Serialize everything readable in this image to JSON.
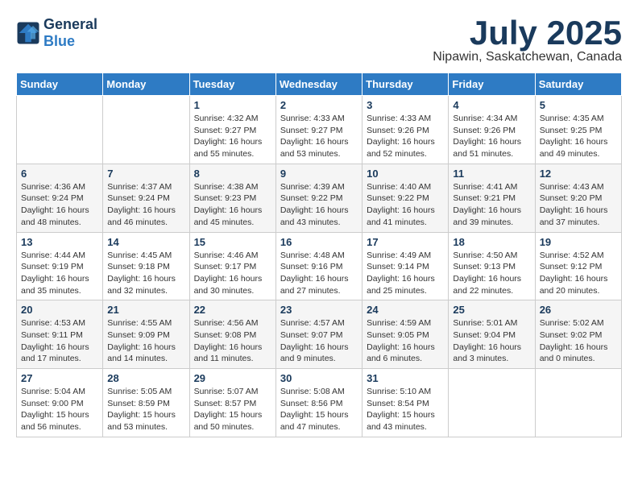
{
  "header": {
    "logo_line1": "General",
    "logo_line2": "Blue",
    "month_title": "July 2025",
    "location": "Nipawin, Saskatchewan, Canada"
  },
  "weekdays": [
    "Sunday",
    "Monday",
    "Tuesday",
    "Wednesday",
    "Thursday",
    "Friday",
    "Saturday"
  ],
  "weeks": [
    [
      {
        "day": "",
        "info": ""
      },
      {
        "day": "",
        "info": ""
      },
      {
        "day": "1",
        "info": "Sunrise: 4:32 AM\nSunset: 9:27 PM\nDaylight: 16 hours\nand 55 minutes."
      },
      {
        "day": "2",
        "info": "Sunrise: 4:33 AM\nSunset: 9:27 PM\nDaylight: 16 hours\nand 53 minutes."
      },
      {
        "day": "3",
        "info": "Sunrise: 4:33 AM\nSunset: 9:26 PM\nDaylight: 16 hours\nand 52 minutes."
      },
      {
        "day": "4",
        "info": "Sunrise: 4:34 AM\nSunset: 9:26 PM\nDaylight: 16 hours\nand 51 minutes."
      },
      {
        "day": "5",
        "info": "Sunrise: 4:35 AM\nSunset: 9:25 PM\nDaylight: 16 hours\nand 49 minutes."
      }
    ],
    [
      {
        "day": "6",
        "info": "Sunrise: 4:36 AM\nSunset: 9:24 PM\nDaylight: 16 hours\nand 48 minutes."
      },
      {
        "day": "7",
        "info": "Sunrise: 4:37 AM\nSunset: 9:24 PM\nDaylight: 16 hours\nand 46 minutes."
      },
      {
        "day": "8",
        "info": "Sunrise: 4:38 AM\nSunset: 9:23 PM\nDaylight: 16 hours\nand 45 minutes."
      },
      {
        "day": "9",
        "info": "Sunrise: 4:39 AM\nSunset: 9:22 PM\nDaylight: 16 hours\nand 43 minutes."
      },
      {
        "day": "10",
        "info": "Sunrise: 4:40 AM\nSunset: 9:22 PM\nDaylight: 16 hours\nand 41 minutes."
      },
      {
        "day": "11",
        "info": "Sunrise: 4:41 AM\nSunset: 9:21 PM\nDaylight: 16 hours\nand 39 minutes."
      },
      {
        "day": "12",
        "info": "Sunrise: 4:43 AM\nSunset: 9:20 PM\nDaylight: 16 hours\nand 37 minutes."
      }
    ],
    [
      {
        "day": "13",
        "info": "Sunrise: 4:44 AM\nSunset: 9:19 PM\nDaylight: 16 hours\nand 35 minutes."
      },
      {
        "day": "14",
        "info": "Sunrise: 4:45 AM\nSunset: 9:18 PM\nDaylight: 16 hours\nand 32 minutes."
      },
      {
        "day": "15",
        "info": "Sunrise: 4:46 AM\nSunset: 9:17 PM\nDaylight: 16 hours\nand 30 minutes."
      },
      {
        "day": "16",
        "info": "Sunrise: 4:48 AM\nSunset: 9:16 PM\nDaylight: 16 hours\nand 27 minutes."
      },
      {
        "day": "17",
        "info": "Sunrise: 4:49 AM\nSunset: 9:14 PM\nDaylight: 16 hours\nand 25 minutes."
      },
      {
        "day": "18",
        "info": "Sunrise: 4:50 AM\nSunset: 9:13 PM\nDaylight: 16 hours\nand 22 minutes."
      },
      {
        "day": "19",
        "info": "Sunrise: 4:52 AM\nSunset: 9:12 PM\nDaylight: 16 hours\nand 20 minutes."
      }
    ],
    [
      {
        "day": "20",
        "info": "Sunrise: 4:53 AM\nSunset: 9:11 PM\nDaylight: 16 hours\nand 17 minutes."
      },
      {
        "day": "21",
        "info": "Sunrise: 4:55 AM\nSunset: 9:09 PM\nDaylight: 16 hours\nand 14 minutes."
      },
      {
        "day": "22",
        "info": "Sunrise: 4:56 AM\nSunset: 9:08 PM\nDaylight: 16 hours\nand 11 minutes."
      },
      {
        "day": "23",
        "info": "Sunrise: 4:57 AM\nSunset: 9:07 PM\nDaylight: 16 hours\nand 9 minutes."
      },
      {
        "day": "24",
        "info": "Sunrise: 4:59 AM\nSunset: 9:05 PM\nDaylight: 16 hours\nand 6 minutes."
      },
      {
        "day": "25",
        "info": "Sunrise: 5:01 AM\nSunset: 9:04 PM\nDaylight: 16 hours\nand 3 minutes."
      },
      {
        "day": "26",
        "info": "Sunrise: 5:02 AM\nSunset: 9:02 PM\nDaylight: 16 hours\nand 0 minutes."
      }
    ],
    [
      {
        "day": "27",
        "info": "Sunrise: 5:04 AM\nSunset: 9:00 PM\nDaylight: 15 hours\nand 56 minutes."
      },
      {
        "day": "28",
        "info": "Sunrise: 5:05 AM\nSunset: 8:59 PM\nDaylight: 15 hours\nand 53 minutes."
      },
      {
        "day": "29",
        "info": "Sunrise: 5:07 AM\nSunset: 8:57 PM\nDaylight: 15 hours\nand 50 minutes."
      },
      {
        "day": "30",
        "info": "Sunrise: 5:08 AM\nSunset: 8:56 PM\nDaylight: 15 hours\nand 47 minutes."
      },
      {
        "day": "31",
        "info": "Sunrise: 5:10 AM\nSunset: 8:54 PM\nDaylight: 15 hours\nand 43 minutes."
      },
      {
        "day": "",
        "info": ""
      },
      {
        "day": "",
        "info": ""
      }
    ]
  ]
}
